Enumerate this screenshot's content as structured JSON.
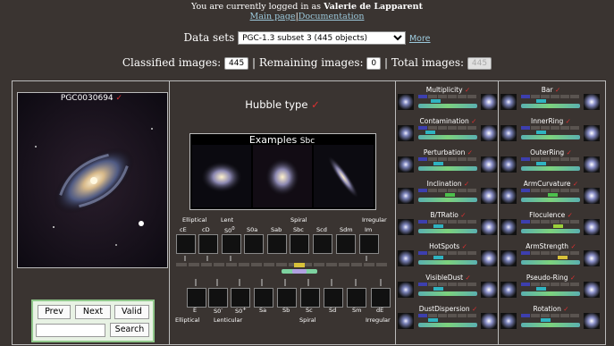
{
  "header": {
    "login_prefix": "You are currently logged in as ",
    "user_name": "Valerie de Lapparent",
    "main_page_link": "Main page",
    "separator": "|",
    "documentation_link": "Documentation"
  },
  "datasets": {
    "label": "Data sets",
    "selected": "PGC-1.3 subset 3 (445 objects)",
    "more_link": "More"
  },
  "counts": {
    "classified_label": "Classified images:",
    "classified_value": "445",
    "sep1": "|",
    "remaining_label": "Remaining images:",
    "remaining_value": "0",
    "sep2": "|",
    "total_label": "Total images:",
    "total_value": "445"
  },
  "galaxy": {
    "name": "PGC0030694",
    "check": "✓"
  },
  "nav": {
    "prev": "Prev",
    "next": "Next",
    "valid": "Valid",
    "search": "Search",
    "search_value": ""
  },
  "hubble": {
    "title": "Hubble type",
    "check": "✓",
    "examples_label": "Examples",
    "examples_type": "Sbc",
    "top_groups": [
      "Elliptical",
      "Lent",
      "Spiral",
      "Irregular"
    ],
    "top_types": [
      "cE",
      "cD",
      "S0",
      "S0a",
      "Sab",
      "Sbc",
      "Scd",
      "Sdm",
      "Im"
    ],
    "s0_superscript": "0",
    "bottom_types": [
      "E",
      "S0",
      "S0",
      "Sa",
      "Sb",
      "Sc",
      "Sd",
      "Sm",
      "dE"
    ],
    "bottom_superscripts": [
      "",
      "-",
      "+",
      "",
      "",
      "",
      "",
      "",
      ""
    ],
    "bottom_groups": [
      "Elliptical",
      "Lenticular",
      "Spiral",
      "Irregular"
    ],
    "selected_fraction": 0.55
  },
  "attributes_left": [
    {
      "label": "Multiplicity",
      "check": "✓",
      "level": 0.25,
      "color": "#2fb3c0"
    },
    {
      "label": "Contamination",
      "check": "✓",
      "level": 0.15,
      "color": "#2fb3c0"
    },
    {
      "label": "Perturbation",
      "check": "✓",
      "level": 0.3,
      "color": "#2fb3c0"
    },
    {
      "label": "Inclination",
      "check": "✓",
      "level": 0.55,
      "color": "#4cc04c"
    },
    {
      "label": "B/TRatio",
      "check": "✓",
      "level": 0.3,
      "color": "#2fb3c0"
    },
    {
      "label": "HotSpots",
      "check": "✓",
      "level": 0.3,
      "color": "#2fb3c0"
    },
    {
      "label": "VisibleDust",
      "check": "✓",
      "level": 0.3,
      "color": "#2fb3c0"
    },
    {
      "label": "DustDispersion",
      "check": "✓",
      "level": 0.2,
      "color": "#2fb3c0"
    }
  ],
  "attributes_right": [
    {
      "label": "Bar",
      "check": "✓",
      "level": 0.3,
      "color": "#2fb3c0"
    },
    {
      "label": "InnerRing",
      "check": "✓",
      "level": 0.3,
      "color": "#2fb3c0"
    },
    {
      "label": "OuterRing",
      "check": "✓",
      "level": 0.3,
      "color": "#2fb3c0"
    },
    {
      "label": "ArmCurvature",
      "check": "✓",
      "level": 0.55,
      "color": "#4cc04c"
    },
    {
      "label": "Floculence",
      "check": "✓",
      "level": 0.65,
      "color": "#9bd13a"
    },
    {
      "label": "ArmStrength",
      "check": "✓",
      "level": 0.75,
      "color": "#d8c23a"
    },
    {
      "label": "Pseudo-Ring",
      "check": "✓",
      "level": 0.3,
      "color": "#2fb3c0"
    },
    {
      "label": "Rotation",
      "check": "✓",
      "level": 0.4,
      "color": "#2fb3c0"
    }
  ],
  "colors": {
    "background": "#3a3431",
    "check": "#e03030",
    "link": "#9cc9dc",
    "nav_box": "#e8f2e4"
  }
}
